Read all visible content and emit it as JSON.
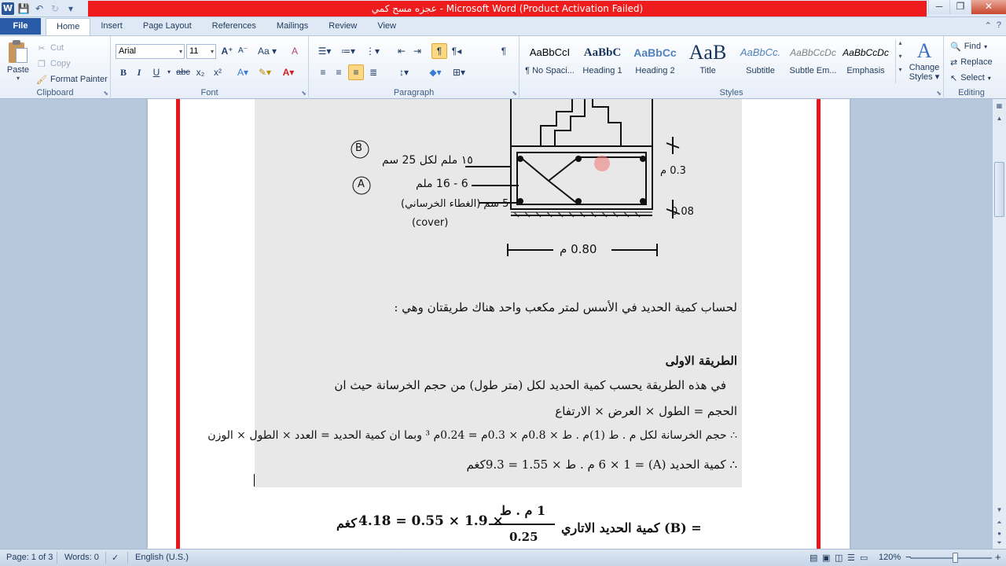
{
  "titlebar": {
    "title": "عجزه مسح كمي  -  Microsoft Word (Product Activation Failed)",
    "app_icon_letter": "W",
    "minimize": "─",
    "maximize": "❐",
    "close": "✕"
  },
  "tabs": {
    "file": "File",
    "items": [
      "Home",
      "Insert",
      "Page Layout",
      "References",
      "Mailings",
      "Review",
      "View"
    ],
    "active": "Home"
  },
  "clipboard": {
    "paste": "Paste",
    "cut": "Cut",
    "copy": "Copy",
    "format_painter": "Format Painter",
    "label": "Clipboard"
  },
  "font": {
    "name": "Arial",
    "size": "11",
    "label": "Font",
    "bold": "B",
    "italic": "I",
    "underline": "U",
    "strike": "abc",
    "subscript": "x₂",
    "superscript": "x²",
    "grow": "A",
    "shrink": "A",
    "change_case": "Aa",
    "clear": "A"
  },
  "paragraph": {
    "label": "Paragraph"
  },
  "styles": {
    "label": "Styles",
    "items": [
      {
        "sample": "AaBbCcI",
        "name": "¶ No Spaci..."
      },
      {
        "sample": "AaBbC",
        "name": "Heading 1"
      },
      {
        "sample": "AaBbCc",
        "name": "Heading 2"
      },
      {
        "sample": "AaB",
        "name": "Title"
      },
      {
        "sample": "AaBbCc.",
        "name": "Subtitle"
      },
      {
        "sample": "AaBbCcDc",
        "name": "Subtle Em..."
      },
      {
        "sample": "AaBbCcDc",
        "name": "Emphasis"
      }
    ],
    "change_styles_line1": "Change",
    "change_styles_line2": "Styles"
  },
  "editing": {
    "label": "Editing",
    "find": "Find",
    "replace": "Replace",
    "select": "Select"
  },
  "document": {
    "hand_B": "B",
    "hand_A": "A",
    "hand_rebar1": "١٥ ملم لكل 25 سم",
    "hand_rebar2": "6 - 16 ملم",
    "hand_cover": "5 سم (الغطاء الخرساني)",
    "hand_cover_en": "(cover)",
    "hand_width": "0.80 م",
    "hand_h1": "0.3 م",
    "hand_h2": "0.08",
    "intro": "لحساب كمية الحديد في الأسس لمتر مكعب واحد هناك طريقتان وهي :",
    "heading1": "الطريقة الاولى",
    "line1": "في هذه الطريقة يحسب كمية الحديد لكل (متر طول) من حجم الخرسانة حيث ان",
    "line2": "الحجم = الطول × العرض × الارتفاع",
    "line3": "∴ حجم الخرسانة لكل م . ط (1)م . ط × 0.8م × 0.3م = 0.24م ³ وبما ان كمية الحديد = العدد × الطول × الوزن",
    "line4": "∴ كمية الحديد (A) = 6 × 1 م . ط × 1.55 = 9.3كغم",
    "formula_result": "4.18 = 0.55 × 1.9 ×",
    "formula_unit": "كغم",
    "formula_num": "1 م . ط",
    "formula_den": "0.25",
    "formula_label": "= (B) كمية الحديد الاتاري"
  },
  "statusbar": {
    "page": "Page: 1 of 3",
    "words": "Words: 0",
    "language": "English (U.S.)",
    "zoom": "120%",
    "zoom_minus": "−",
    "zoom_plus": "+"
  },
  "colors": {
    "file_tab": "#2a5ba8",
    "title_bar_alert": "#ee1c1c",
    "page_border": "#e8161a",
    "highlight": "#fcd981"
  }
}
